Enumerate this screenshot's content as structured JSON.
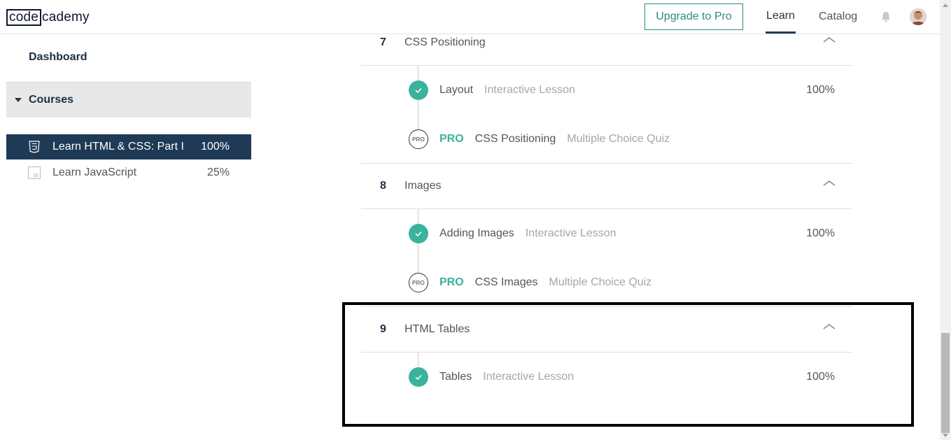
{
  "header": {
    "logo_part1": "code",
    "logo_part2": "cademy",
    "upgrade_label": "Upgrade to Pro",
    "nav_learn": "Learn",
    "nav_catalog": "Catalog"
  },
  "sidebar": {
    "dashboard": "Dashboard",
    "courses_label": "Courses",
    "courses": [
      {
        "name": "Learn HTML & CSS: Part I",
        "progress": "100%",
        "icon": "html5-icon"
      },
      {
        "name": "Learn JavaScript",
        "progress": "25%",
        "icon": "js-icon"
      }
    ]
  },
  "sections": [
    {
      "number": "7",
      "title": "CSS Positioning",
      "lessons": [
        {
          "name": "Layout",
          "type": "Interactive Lesson",
          "progress": "100%",
          "status": "complete"
        },
        {
          "pro": "PRO",
          "name": "CSS Positioning",
          "type": "Multiple Choice Quiz",
          "badge": "PRO"
        }
      ]
    },
    {
      "number": "8",
      "title": "Images",
      "lessons": [
        {
          "name": "Adding Images",
          "type": "Interactive Lesson",
          "progress": "100%",
          "status": "complete"
        },
        {
          "pro": "PRO",
          "name": "CSS Images",
          "type": "Multiple Choice Quiz",
          "badge": "PRO"
        }
      ]
    },
    {
      "number": "9",
      "title": "HTML Tables",
      "lessons": [
        {
          "name": "Tables",
          "type": "Interactive Lesson",
          "progress": "100%",
          "status": "complete"
        }
      ]
    }
  ],
  "colors": {
    "accent_teal": "#3bb39c",
    "navy": "#1f3a56",
    "upgrade_border": "#2c8b82"
  }
}
